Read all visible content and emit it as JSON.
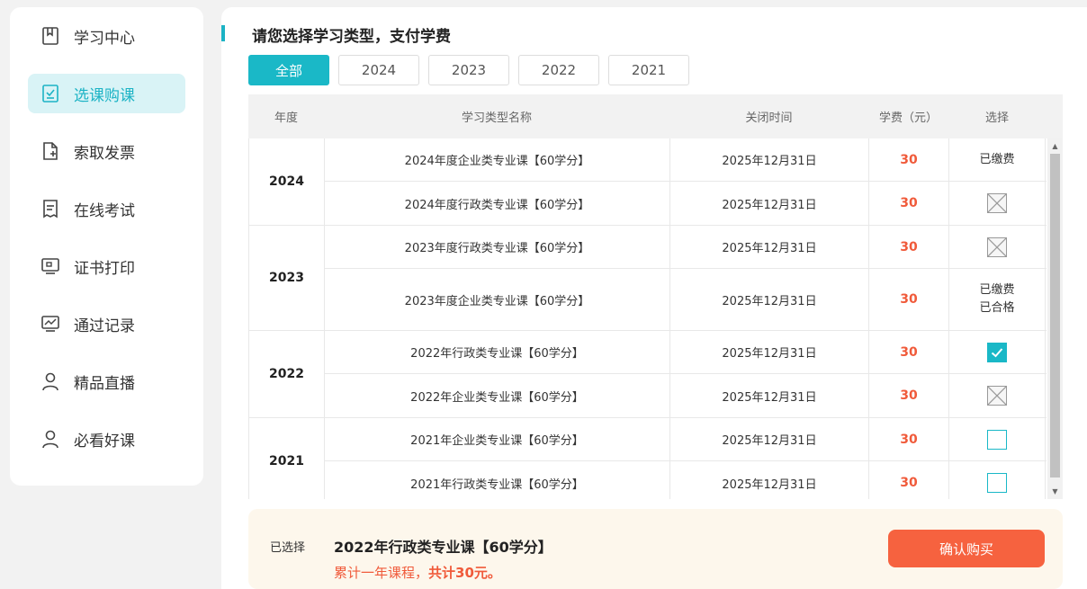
{
  "sidebar": {
    "items": [
      {
        "label": "学习中心",
        "icon": "bookmark-icon"
      },
      {
        "label": "选课购课",
        "icon": "checklist-icon",
        "active": true
      },
      {
        "label": "索取发票",
        "icon": "invoice-add-icon"
      },
      {
        "label": "在线考试",
        "icon": "exam-paper-icon"
      },
      {
        "label": "证书打印",
        "icon": "monitor-print-icon"
      },
      {
        "label": "通过记录",
        "icon": "chart-record-icon"
      },
      {
        "label": "精品直播",
        "icon": "user-icon"
      },
      {
        "label": "必看好课",
        "icon": "user-icon"
      }
    ]
  },
  "main": {
    "title": "请您选择学习类型，支付学费",
    "filters": [
      "全部",
      "2024",
      "2023",
      "2022",
      "2021"
    ],
    "active_filter": "全部",
    "columns": [
      "年度",
      "学习类型名称",
      "关闭时间",
      "学费（元）",
      "选择"
    ],
    "groups": [
      {
        "year": "2024",
        "rows": [
          {
            "name": "2024年度企业类专业课【60学分】",
            "close": "2025年12月31日",
            "fee": "30",
            "status": "paid",
            "status_text": "已缴费"
          },
          {
            "name": "2024年度行政类专业课【60学分】",
            "close": "2025年12月31日",
            "fee": "30",
            "status": "disabled"
          }
        ]
      },
      {
        "year": "2023",
        "rows": [
          {
            "name": "2023年度行政类专业课【60学分】",
            "close": "2025年12月31日",
            "fee": "30",
            "status": "disabled"
          },
          {
            "name": "2023年度企业类专业课【60学分】",
            "close": "2025年12月31日",
            "fee": "30",
            "status": "paid",
            "status_text": "已缴费",
            "status_text2": "已合格"
          }
        ]
      },
      {
        "year": "2022",
        "rows": [
          {
            "name": "2022年行政类专业课【60学分】",
            "close": "2025年12月31日",
            "fee": "30",
            "status": "checked"
          },
          {
            "name": "2022年企业类专业课【60学分】",
            "close": "2025年12月31日",
            "fee": "30",
            "status": "disabled"
          }
        ]
      },
      {
        "year": "2021",
        "rows": [
          {
            "name": "2021年企业类专业课【60学分】",
            "close": "2025年12月31日",
            "fee": "30",
            "status": "unchecked"
          },
          {
            "name": "2021年行政类专业课【60学分】",
            "close": "2025年12月31日",
            "fee": "30",
            "status": "unchecked"
          }
        ]
      }
    ]
  },
  "summary": {
    "label": "已选择",
    "selected_name": "2022年行政类专业课【60学分】",
    "sum_prefix": "累计一年课程，",
    "sum_total": "共计30元。",
    "buy_label": "确认购买"
  },
  "colors": {
    "accent": "#1ab8c7",
    "price": "#f05a3a",
    "buy": "#f6623f",
    "summary_bg": "#fdf7ec"
  }
}
